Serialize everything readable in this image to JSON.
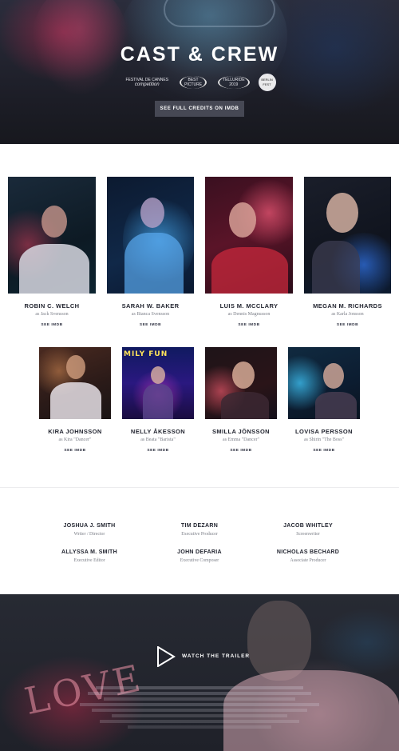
{
  "hero": {
    "title": "CAST & CREW",
    "imdb_button": "SEE FULL CREDITS ON IMDB",
    "laurels": [
      {
        "line1": "FESTIVAL DE CANNES",
        "line2": "competition"
      },
      {
        "line1": "BEST",
        "line2": "PICTURE"
      },
      {
        "line1": "TELLURIDE",
        "line2": "2019"
      },
      {
        "line1": "BERLIN",
        "line2": "FEST"
      }
    ]
  },
  "cast": [
    {
      "name": "ROBIN C. WELCH",
      "role": "as Jack Svensson",
      "link": "SEE IMDB",
      "accent": "#2bb9d2"
    },
    {
      "name": "SARAH W. BAKER",
      "role": "as Bianca Svensson",
      "link": "SEE IMDB",
      "accent": "#3aa8f0"
    },
    {
      "name": "LUIS M. MCCLARY",
      "role": "as Dennis Magnusson",
      "link": "SEE IMDB",
      "accent": "#e43a5e"
    },
    {
      "name": "MEGAN M. RICHARDS",
      "role": "as Karla Jonsson",
      "link": "SEE IMDB",
      "accent": "#2f6fd8"
    },
    {
      "name": "KIRA JOHNSSON",
      "role": "as Kira \"Dancer\"",
      "link": "SEE IMDB",
      "accent": "#d38a5a"
    },
    {
      "name": "NELLY ÅKESSON",
      "role": "as Beata \"Barista\"",
      "link": "SEE IMDB",
      "accent": "#3b6ee8"
    },
    {
      "name": "SMILLA JÖNSSON",
      "role": "as Emma \"Dancer\"",
      "link": "SEE IMDB",
      "accent": "#e06080"
    },
    {
      "name": "LOVISA PERSSON",
      "role": "as Shirin \"The Boss\"",
      "link": "SEE IMDB",
      "accent": "#2a9fc8"
    }
  ],
  "crew": [
    {
      "name": "JOSHUA J. SMITH",
      "title": "Writer / Director"
    },
    {
      "name": "TIM DEZARN",
      "title": "Executive Producer"
    },
    {
      "name": "JACOB WHITLEY",
      "title": "Screenwriter"
    },
    {
      "name": "ALLYSSA M. SMITH",
      "title": "Executive Editor"
    },
    {
      "name": "JOHN DEFARIA",
      "title": "Executive Composer"
    },
    {
      "name": "NICHOLAS BECHARD",
      "title": "Associate Producer"
    }
  ],
  "trailer": {
    "label": "WATCH THE TRAILER",
    "neon_sign": "LOVE"
  }
}
